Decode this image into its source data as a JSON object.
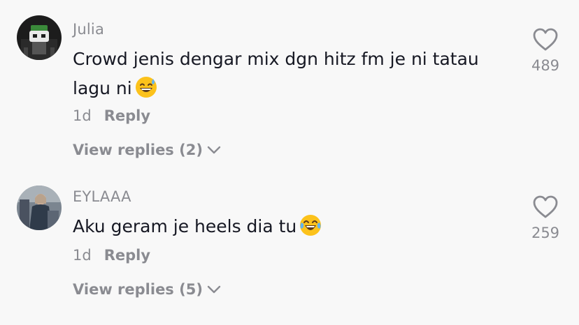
{
  "comments": [
    {
      "username": "Julia",
      "text": "Crowd jenis dengar mix dgn hitz fm je ni tatau lagu ni",
      "emoji": "grinning-sweat-emoji",
      "time": "1d",
      "reply_label": "Reply",
      "view_replies": "View replies (2)",
      "likes": "489",
      "icons": {
        "like": "heart-outline-icon",
        "expand": "chevron-down-icon"
      }
    },
    {
      "username": "EYLAAA",
      "text": "Aku geram je heels dia tu",
      "emoji": "tears-of-joy-emoji",
      "time": "1d",
      "reply_label": "Reply",
      "view_replies": "View replies (5)",
      "likes": "259",
      "icons": {
        "like": "heart-outline-icon",
        "expand": "chevron-down-icon"
      }
    }
  ],
  "colors": {
    "background": "#f8f8f8",
    "primary_text": "#161823",
    "secondary_text": "#8a8b91",
    "emoji_yellow": "#fcc21b",
    "tear_blue": "#63b3ed"
  }
}
